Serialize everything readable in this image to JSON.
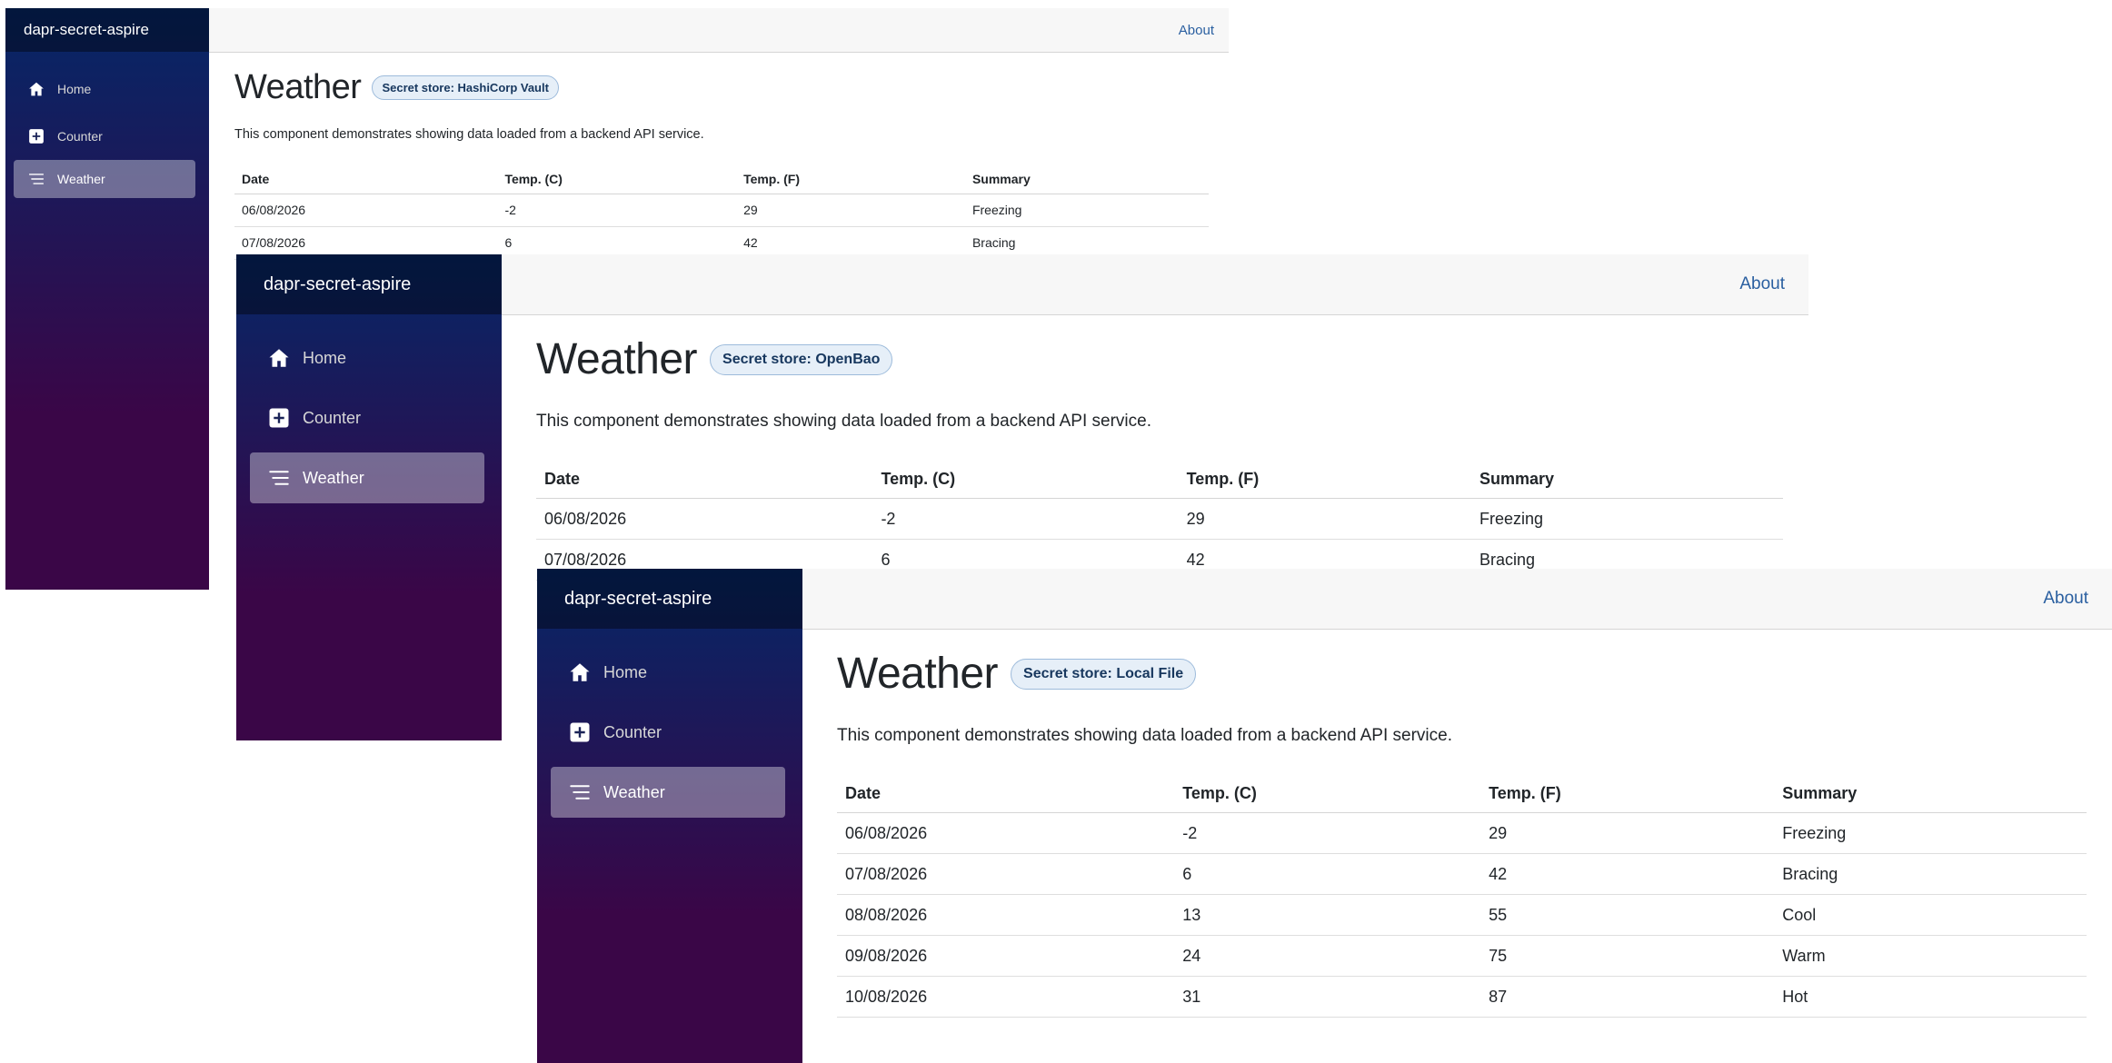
{
  "app": {
    "brand": "dapr-secret-aspire",
    "about_label": "About",
    "nav": [
      {
        "label": "Home",
        "icon": "home-icon"
      },
      {
        "label": "Counter",
        "icon": "plus-square-icon"
      },
      {
        "label": "Weather",
        "icon": "list-icon"
      }
    ],
    "active_nav": "Weather"
  },
  "page": {
    "title": "Weather",
    "description": "This component demonstrates showing data loaded from a backend API service."
  },
  "table": {
    "headers": [
      "Date",
      "Temp. (C)",
      "Temp. (F)",
      "Summary"
    ],
    "rows": [
      [
        "06/08/2026",
        "-2",
        "29",
        "Freezing"
      ],
      [
        "07/08/2026",
        "6",
        "42",
        "Bracing"
      ],
      [
        "08/08/2026",
        "13",
        "55",
        "Cool"
      ],
      [
        "09/08/2026",
        "24",
        "75",
        "Warm"
      ],
      [
        "10/08/2026",
        "31",
        "87",
        "Hot"
      ]
    ]
  },
  "windows": [
    {
      "badge": "Secret store: HashiCorp Vault",
      "visible_rows": 2
    },
    {
      "badge": "Secret store: OpenBao",
      "visible_rows": 2
    },
    {
      "badge": "Secret store: Local File",
      "visible_rows": 5
    }
  ],
  "colors": {
    "sidebar_gradient_top": "#052767",
    "sidebar_gradient_bottom": "#3a0647",
    "link": "#2a5fa0",
    "badge_bg": "#e6eff8",
    "badge_text": "#17375e"
  }
}
